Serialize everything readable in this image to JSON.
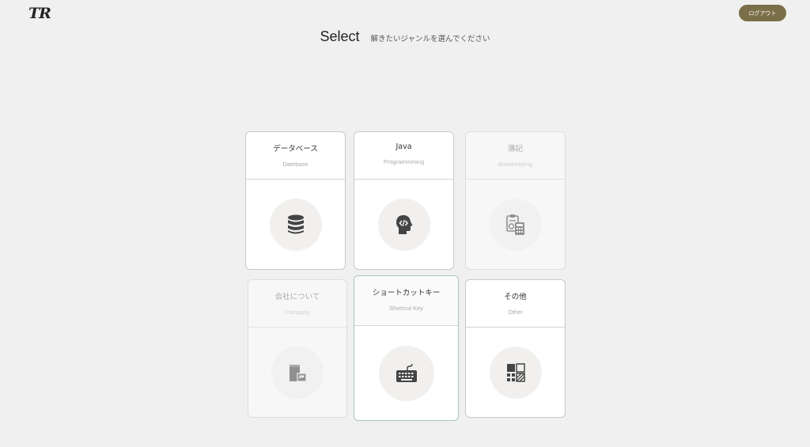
{
  "header": {
    "logo": "TR",
    "logout_label": "ログアウト",
    "title": "Select",
    "subtitle": "解きたいジャンルを選んでください"
  },
  "genres": [
    {
      "name": "データベース",
      "en": "Datebase",
      "icon": "database-icon",
      "enabled": true
    },
    {
      "name": "Java",
      "en": "Programmming",
      "icon": "java-code-head-icon",
      "enabled": true
    },
    {
      "name": "簿記",
      "en": "Bookkeeping",
      "icon": "bookkeeping-calculator-icon",
      "enabled": false
    },
    {
      "name": "会社について",
      "en": "Company",
      "icon": "company-building-icon",
      "enabled": false
    },
    {
      "name": "ショートカットキー",
      "en": "Shortcut Key",
      "icon": "keyboard-icon",
      "enabled": true
    },
    {
      "name": "その他",
      "en": "Other",
      "icon": "other-grid-icon",
      "enabled": true
    }
  ],
  "colors": {
    "background": "#f0f0f0",
    "logout_button": "#7a6f48",
    "icon": "#444444"
  }
}
